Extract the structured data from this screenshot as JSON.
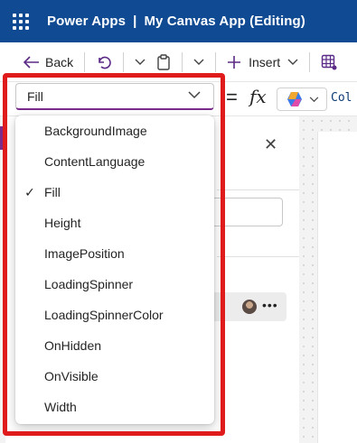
{
  "header": {
    "product": "Power Apps",
    "separator": "|",
    "app_name": "My Canvas App (Editing)"
  },
  "command_bar": {
    "back_label": "Back",
    "insert_label": "Insert"
  },
  "formula_bar": {
    "selected_property": "Fill",
    "equals": "=",
    "fx": "fx",
    "formula_text": "Col"
  },
  "property_dropdown": {
    "options": [
      {
        "label": "BackgroundImage",
        "selected": false
      },
      {
        "label": "ContentLanguage",
        "selected": false
      },
      {
        "label": "Fill",
        "selected": true
      },
      {
        "label": "Height",
        "selected": false
      },
      {
        "label": "ImagePosition",
        "selected": false
      },
      {
        "label": "LoadingSpinner",
        "selected": false
      },
      {
        "label": "LoadingSpinnerColor",
        "selected": false
      },
      {
        "label": "OnHidden",
        "selected": false
      },
      {
        "label": "OnVisible",
        "selected": false
      },
      {
        "label": "Width",
        "selected": false
      }
    ],
    "check_glyph": "✓"
  },
  "colors": {
    "header_bg": "#0f4a92",
    "accent": "#7a2b8c",
    "highlight_frame": "#e01b1b"
  },
  "icons": [
    "waffle-icon",
    "back-arrow-icon",
    "undo-icon",
    "chevron-down-icon",
    "paste-icon",
    "plus-icon",
    "table-icon",
    "copilot-icon",
    "close-icon",
    "more-icon",
    "checkmark-icon"
  ]
}
